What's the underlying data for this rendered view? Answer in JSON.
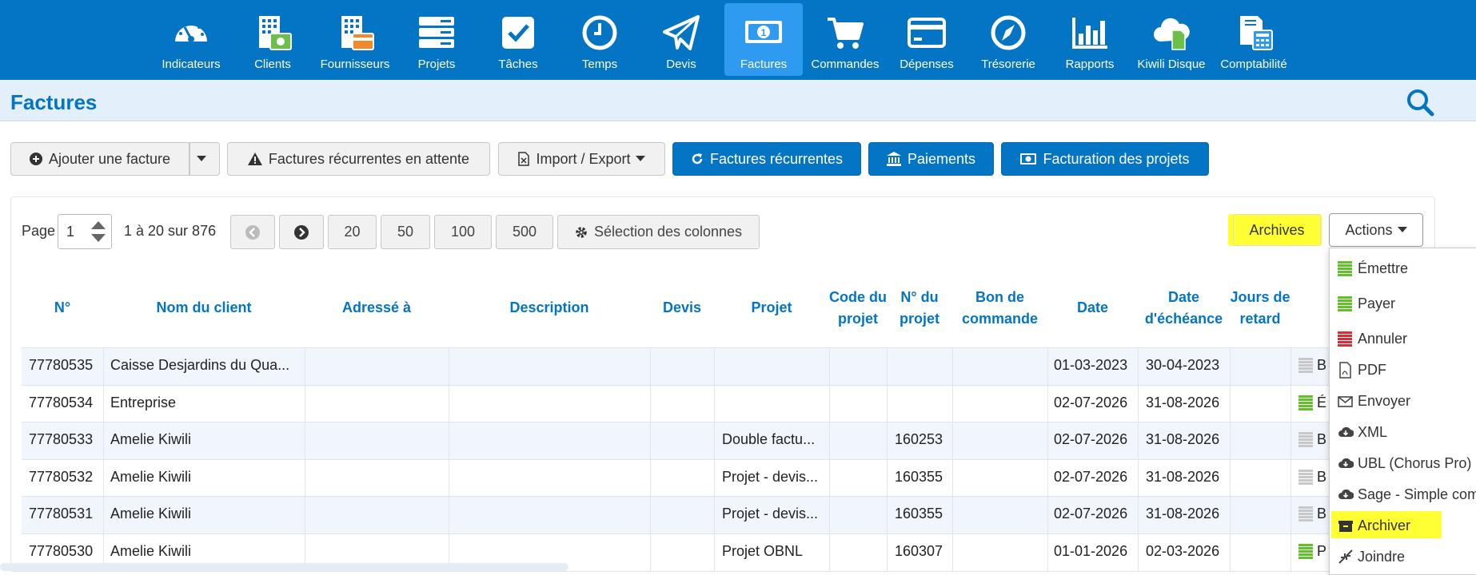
{
  "nav": {
    "items": [
      {
        "label": "Indicateurs",
        "icon": "gauge-icon"
      },
      {
        "label": "Clients",
        "icon": "clients-building-icon"
      },
      {
        "label": "Fournisseurs",
        "icon": "suppliers-building-icon"
      },
      {
        "label": "Projets",
        "icon": "projects-icon"
      },
      {
        "label": "Tâches",
        "icon": "tasks-checkbox-icon"
      },
      {
        "label": "Temps",
        "icon": "clock-icon"
      },
      {
        "label": "Devis",
        "icon": "paper-plane-icon"
      },
      {
        "label": "Factures",
        "icon": "banknote-icon"
      },
      {
        "label": "Commandes",
        "icon": "cart-icon"
      },
      {
        "label": "Dépenses",
        "icon": "credit-card-icon"
      },
      {
        "label": "Trésorerie",
        "icon": "compass-icon"
      },
      {
        "label": "Rapports",
        "icon": "bar-chart-icon"
      },
      {
        "label": "Kiwili Disque",
        "icon": "cloud-document-icon"
      },
      {
        "label": "Comptabilité",
        "icon": "accounting-icon"
      }
    ],
    "active": "Factures"
  },
  "header": {
    "title": "Factures"
  },
  "toolbar": {
    "add_invoice": "Ajouter une facture",
    "pending_recurring": "Factures récurrentes en attente",
    "import_export": "Import / Export",
    "recurring": "Factures récurrentes",
    "payments": "Paiements",
    "project_billing": "Facturation des projets"
  },
  "pager": {
    "label": "Page",
    "current_page": "1",
    "range": "1 à 20 sur 876",
    "sizes": [
      "20",
      "50",
      "100",
      "500"
    ],
    "columns_button": "Sélection des colonnes",
    "archives": "Archives",
    "actions": "Actions"
  },
  "table": {
    "headers": [
      "N°",
      "Nom du client",
      "Adressé à",
      "Description",
      "Devis",
      "Projet",
      "Code du projet",
      "N° du projet",
      "Bon de commande",
      "Date",
      "Date d'échéance",
      "Jours de retard"
    ],
    "rows": [
      {
        "num": "77780535",
        "client": "Caisse Desjardins du Qua...",
        "project": "",
        "project_no": "",
        "date": "01-03-2023",
        "due": "30-04-2023",
        "status_letter": "B",
        "status_color": "#c8c8c8"
      },
      {
        "num": "77780534",
        "client": "Entreprise",
        "project": "",
        "project_no": "",
        "date": "02-07-2026",
        "due": "31-08-2026",
        "status_letter": "É",
        "status_color": "#5cc425"
      },
      {
        "num": "77780533",
        "client": "Amelie Kiwili",
        "project": "Double factu...",
        "project_no": "160253",
        "date": "02-07-2026",
        "due": "31-08-2026",
        "status_letter": "B",
        "status_color": "#c8c8c8"
      },
      {
        "num": "77780532",
        "client": "Amelie Kiwili",
        "project": "Projet - devis...",
        "project_no": "160355",
        "date": "02-07-2026",
        "due": "31-08-2026",
        "status_letter": "B",
        "status_color": "#c8c8c8"
      },
      {
        "num": "77780531",
        "client": "Amelie Kiwili",
        "project": "Projet - devis...",
        "project_no": "160355",
        "date": "02-07-2026",
        "due": "31-08-2026",
        "status_letter": "B",
        "status_color": "#c8c8c8"
      },
      {
        "num": "77780530",
        "client": "Amelie Kiwili",
        "project": "Projet OBNL",
        "project_no": "160307",
        "date": "01-01-2026",
        "due": "02-03-2026",
        "status_letter": "P",
        "status_color": "#5cc425"
      }
    ]
  },
  "actions_menu": {
    "items": [
      {
        "label": "Émettre",
        "icon": "green-bars-icon"
      },
      {
        "label": "Payer",
        "icon": "green-bars-icon"
      },
      {
        "label": "Annuler",
        "icon": "red-bars-icon"
      },
      {
        "label": "PDF",
        "icon": "pdf-file-icon"
      },
      {
        "label": "Envoyer",
        "icon": "envelope-icon"
      },
      {
        "label": "XML",
        "icon": "cloud-download-icon"
      },
      {
        "label": "UBL (Chorus Pro)",
        "icon": "cloud-download-icon"
      },
      {
        "label": "Sage - Simple comptable",
        "icon": "cloud-download-icon"
      },
      {
        "label": "Archiver",
        "icon": "archive-box-icon"
      },
      {
        "label": "Joindre",
        "icon": "merge-arrows-icon"
      }
    ]
  },
  "colors": {
    "brand": "#0474c4",
    "active_nav": "#2f9bf0",
    "highlight": "#ffff33",
    "green": "#5cc425",
    "red": "#e8262d"
  }
}
